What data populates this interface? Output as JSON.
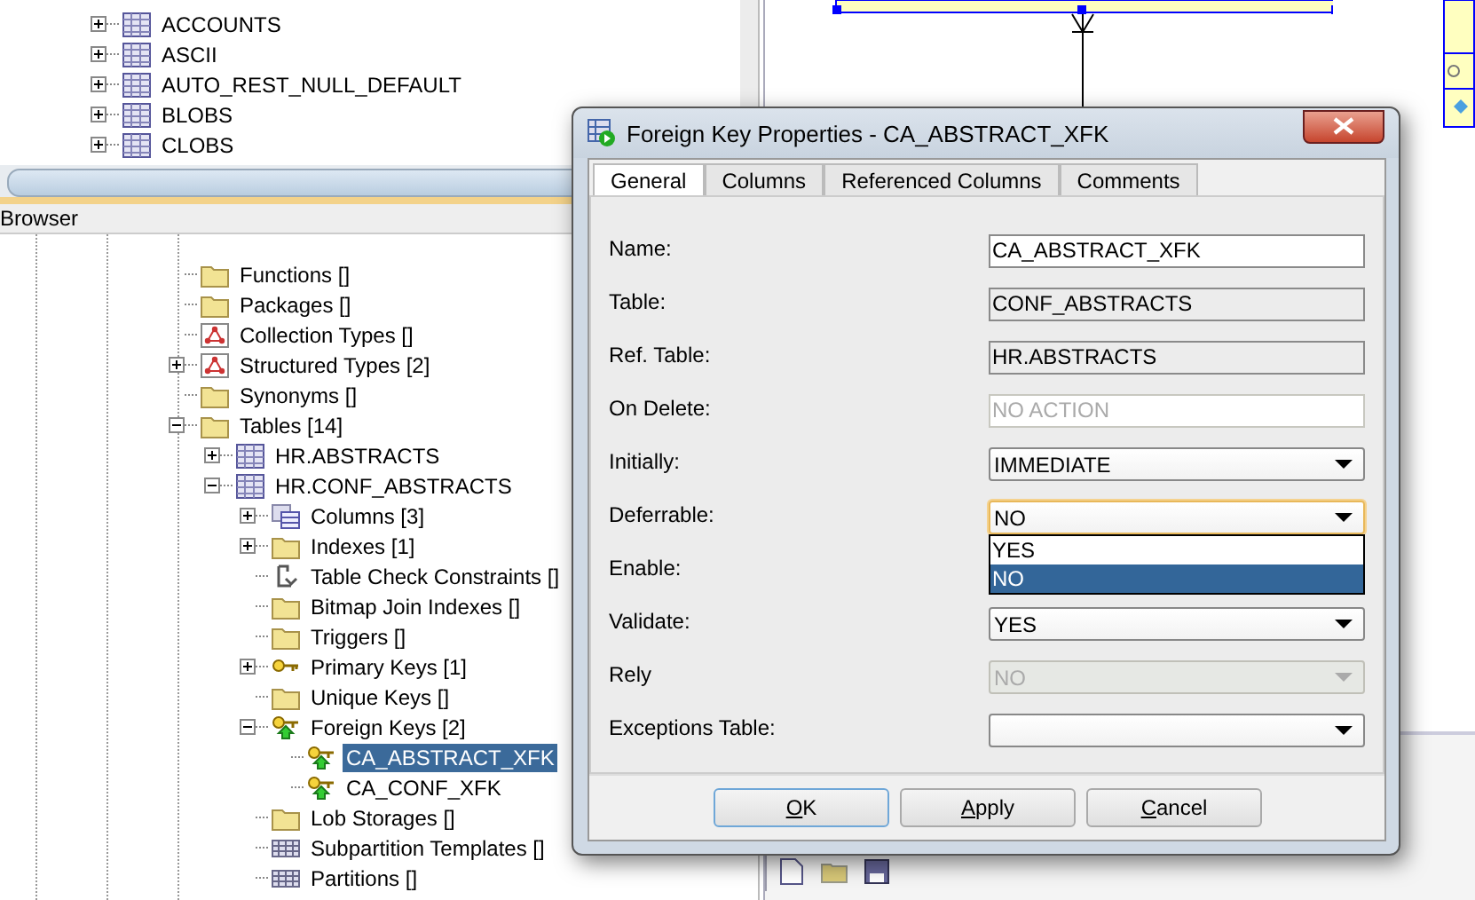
{
  "top_tree": {
    "items": [
      {
        "label": "ACCOUNTS",
        "expanded": false,
        "selected": false
      },
      {
        "label": "ASCII",
        "expanded": false,
        "selected": false
      },
      {
        "label": "AUTO_REST_NULL_DEFAULT",
        "expanded": false,
        "selected": false
      },
      {
        "label": "BLOBS",
        "expanded": false,
        "selected": false
      },
      {
        "label": "CLOBS",
        "expanded": false,
        "selected": false
      }
    ]
  },
  "browser": {
    "title": "Browser",
    "tree": [
      {
        "label": "Functions []",
        "kind": "folder",
        "selected": false
      },
      {
        "label": "Packages []",
        "kind": "folder",
        "selected": false
      },
      {
        "label": "Collection Types []",
        "kind": "type",
        "selected": false
      },
      {
        "label": "Structured Types [2]",
        "kind": "type",
        "expanded": false,
        "selected": false
      },
      {
        "label": "Synonyms []",
        "kind": "folder",
        "selected": false
      },
      {
        "label": "Tables [14]",
        "kind": "folder",
        "expanded": true,
        "selected": false,
        "children": [
          {
            "label": "HR.ABSTRACTS",
            "kind": "table",
            "expanded": false,
            "selected": false
          },
          {
            "label": "HR.CONF_ABSTRACTS",
            "kind": "table",
            "expanded": true,
            "selected": false,
            "children": [
              {
                "label": "Columns [3]",
                "kind": "columns",
                "expanded": false,
                "selected": false
              },
              {
                "label": "Indexes [1]",
                "kind": "folder",
                "expanded": false,
                "selected": false
              },
              {
                "label": "Table Check Constraints []",
                "kind": "check",
                "selected": false
              },
              {
                "label": "Bitmap Join Indexes []",
                "kind": "folder",
                "selected": false
              },
              {
                "label": "Triggers []",
                "kind": "folder",
                "selected": false
              },
              {
                "label": "Primary Keys [1]",
                "kind": "key",
                "expanded": false,
                "selected": false
              },
              {
                "label": "Unique Keys []",
                "kind": "folder",
                "selected": false
              },
              {
                "label": "Foreign Keys [2]",
                "kind": "foreign-key",
                "expanded": true,
                "selected": false,
                "children": [
                  {
                    "label": "CA_ABSTRACT_XFK",
                    "kind": "foreign-key",
                    "selected": true
                  },
                  {
                    "label": "CA_CONF_XFK",
                    "kind": "foreign-key",
                    "selected": false
                  }
                ]
              },
              {
                "label": "Lob Storages []",
                "kind": "folder",
                "selected": false
              },
              {
                "label": "Subpartition Templates []",
                "kind": "partition",
                "selected": false
              },
              {
                "label": "Partitions []",
                "kind": "partition",
                "selected": false
              }
            ]
          }
        ]
      }
    ]
  },
  "dialog": {
    "title": "Foreign Key Properties - CA_ABSTRACT_XFK",
    "tabs": [
      {
        "label": "General",
        "selected": true
      },
      {
        "label": "Columns",
        "selected": false
      },
      {
        "label": "Referenced Columns",
        "selected": false
      },
      {
        "label": "Comments",
        "selected": false
      }
    ],
    "fields": [
      {
        "label": "Name:",
        "kind": "text",
        "value": "CA_ABSTRACT_XFK",
        "readonly": false,
        "disabled": false
      },
      {
        "label": "Table:",
        "kind": "text",
        "value": "CONF_ABSTRACTS",
        "readonly": true,
        "disabled": false
      },
      {
        "label": "Ref. Table:",
        "kind": "text",
        "value": "HR.ABSTRACTS",
        "readonly": true,
        "disabled": false
      },
      {
        "label": "On Delete:",
        "kind": "text",
        "value": "NO ACTION",
        "readonly": false,
        "disabled": true
      },
      {
        "label": "Initially:",
        "kind": "select",
        "value": "IMMEDIATE",
        "disabled": false,
        "focused": false
      },
      {
        "label": "Deferrable:",
        "kind": "select",
        "value": "NO",
        "disabled": false,
        "focused": true,
        "expanded": true,
        "options": [
          {
            "label": "YES",
            "selected": false
          },
          {
            "label": "NO",
            "selected": true
          }
        ]
      },
      {
        "label": "Enable:",
        "kind": "label"
      },
      {
        "label": "Validate:",
        "kind": "select",
        "value": "YES",
        "disabled": false,
        "focused": false
      },
      {
        "label": "Rely",
        "kind": "select",
        "value": "NO",
        "disabled": true,
        "focused": false
      },
      {
        "label": "Exceptions Table:",
        "kind": "select",
        "disabled": false,
        "focused": false
      }
    ],
    "buttons": [
      {
        "label": "OK",
        "default": true
      },
      {
        "label": "Apply",
        "default": false
      },
      {
        "label": "Cancel",
        "default": false
      }
    ]
  }
}
